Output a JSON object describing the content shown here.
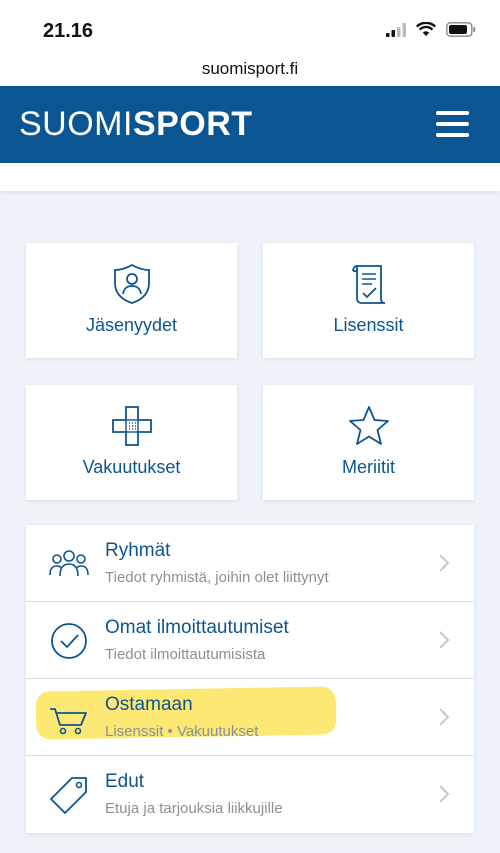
{
  "status_bar": {
    "time": "21.16"
  },
  "browser": {
    "url": "suomisport.fi"
  },
  "header": {
    "logo_part1": "SUOMI",
    "logo_part2": "SPORT",
    "brand_color": "#0a5592"
  },
  "tiles": [
    {
      "label": "Jäsenyydet",
      "icon": "shield-person-icon"
    },
    {
      "label": "Lisenssit",
      "icon": "certificate-icon"
    },
    {
      "label": "Vakuutukset",
      "icon": "bandage-cross-icon"
    },
    {
      "label": "Meriitit",
      "icon": "star-icon"
    }
  ],
  "list": [
    {
      "title": "Ryhmät",
      "subtitle": "Tiedot ryhmistä, joihin olet liittynyt",
      "icon": "people-icon"
    },
    {
      "title": "Omat ilmoittautumiset",
      "subtitle": "Tiedot ilmoittautumisista",
      "icon": "check-circle-icon"
    },
    {
      "title": "Ostamaan",
      "subtitle": "Lisenssit • Vakuutukset",
      "icon": "cart-icon",
      "highlight_color": "#fbe45a"
    },
    {
      "title": "Edut",
      "subtitle": "Etuja ja tarjouksia liikkujille",
      "icon": "tag-icon"
    }
  ]
}
